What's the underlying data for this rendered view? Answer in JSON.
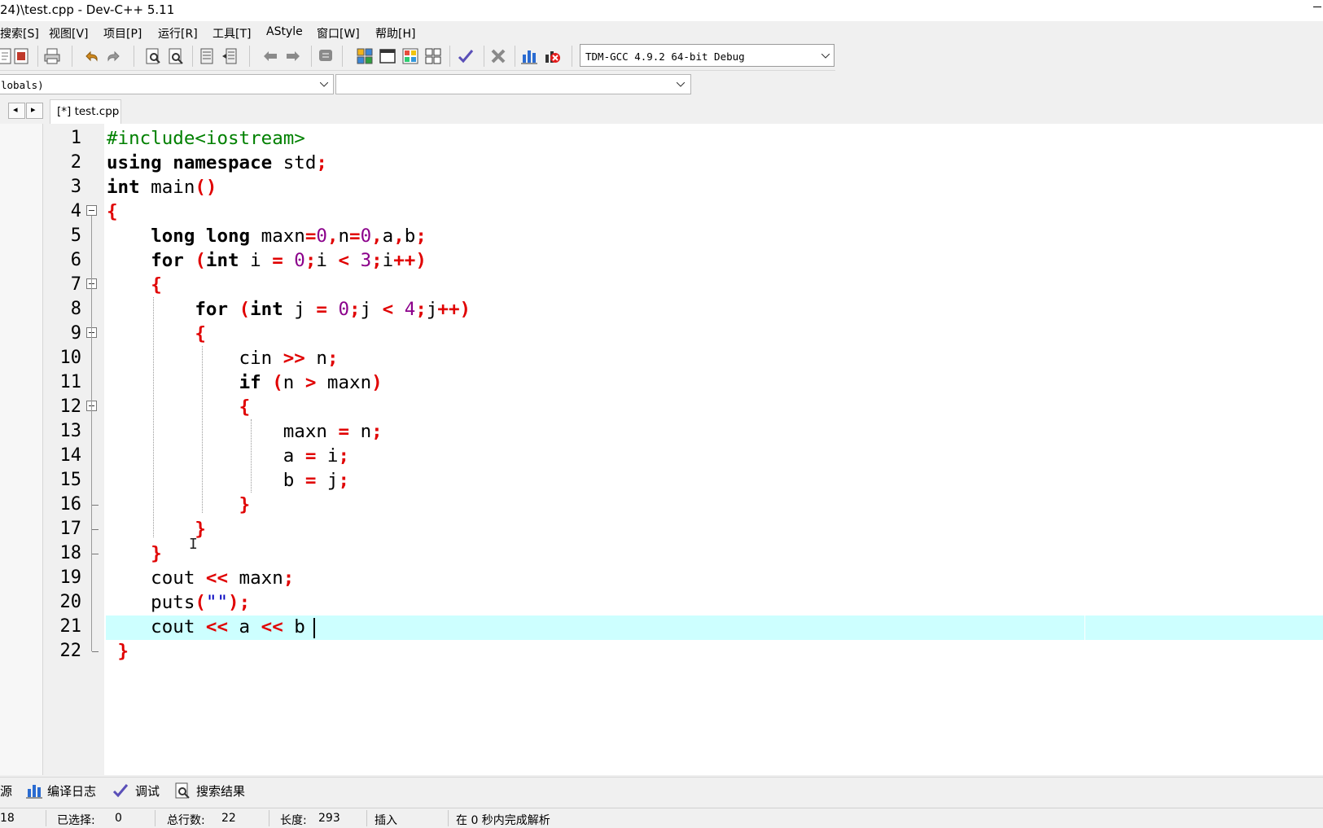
{
  "window": {
    "title": "24)\\test.cpp - Dev-C++ 5.11"
  },
  "menu": [
    "搜索[S]",
    "视图[V]",
    "项目[P]",
    "运行[R]",
    "工具[T]",
    "AStyle",
    "窗口[W]",
    "帮助[H]"
  ],
  "toolbar": {
    "icons": [
      "new-icon",
      "open-icon",
      "print-icon",
      "undo-icon",
      "redo-icon",
      "find-icon",
      "replace-icon",
      "indent-icon",
      "unindent-icon",
      "toggle-bookmark-icon",
      "goto-bookmark-icon",
      "comment-icon",
      "compile-icon",
      "run-icon",
      "compile-run-icon",
      "rebuild-icon",
      "syntax-check-icon",
      "stop-icon",
      "chart-icon",
      "profile-icon"
    ],
    "compiler_select": "TDM-GCC 4.9.2 64-bit Debug"
  },
  "classbar": {
    "scope_select": "lobals)",
    "member_select": ""
  },
  "tabs": {
    "nav_prev": "◂",
    "nav_next": "▸",
    "active_tab": "[*] test.cpp"
  },
  "editor": {
    "line_numbers": [
      "1",
      "2",
      "3",
      "4",
      "5",
      "6",
      "7",
      "8",
      "9",
      "10",
      "11",
      "12",
      "13",
      "14",
      "15",
      "16",
      "17",
      "18",
      "19",
      "20",
      "21",
      "22"
    ],
    "lines": [
      "#include<iostream>",
      "using namespace std;",
      "int main()",
      "{",
      "    long long maxn=0,n=0,a,b;",
      "    for (int i = 0;i < 3;i++)",
      "    {",
      "        for (int j = 0;j < 4;j++)",
      "        {",
      "            cin >> n;",
      "            if (n > maxn)",
      "            {",
      "                maxn = n;",
      "                a = i;",
      "                b = j;",
      "            }",
      "        }",
      "    }",
      "    cout << maxn;",
      "    puts(\"\");",
      "    cout << a << b",
      " }"
    ],
    "current_line": 21
  },
  "bottom_tabs": [
    "源",
    "编译日志",
    "调试",
    "搜索结果"
  ],
  "status": {
    "line": "18",
    "selected_label": "已选择:",
    "selected_value": "0",
    "total_label": "总行数:",
    "total_value": "22",
    "length_label": "长度:",
    "length_value": "293",
    "mode": "插入",
    "parse_msg": "在 0 秒内完成解析"
  },
  "colors": {
    "keyword": "#000000",
    "punct": "#e00000",
    "number": "#8b008b",
    "preprocessor": "#008000",
    "current_line": "#cdffff"
  }
}
